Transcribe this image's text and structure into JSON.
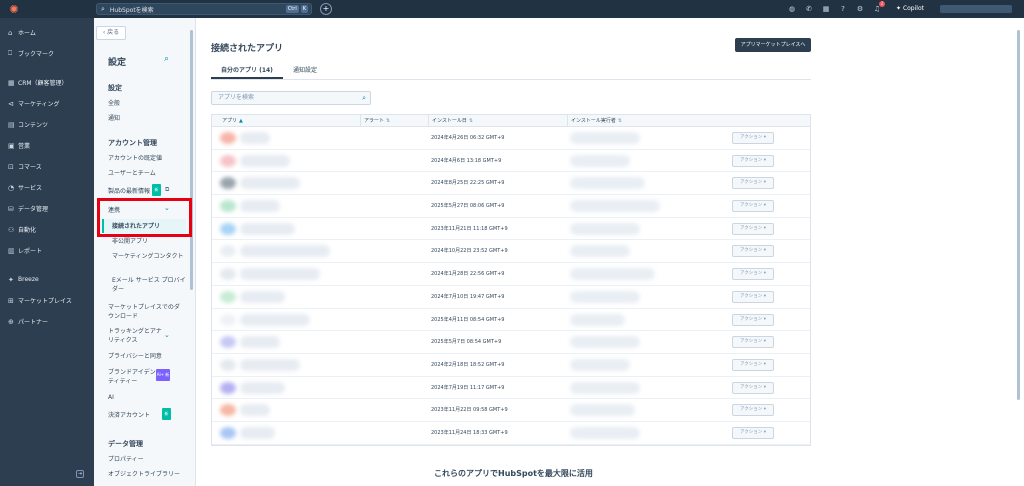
{
  "topbar": {
    "logo": "✺",
    "search_placeholder": "HubSpotを検索",
    "shortcut_keys": [
      "Ctrl",
      "K"
    ],
    "copilot_label": "Copilot",
    "notification_count": "1"
  },
  "nav": {
    "items": [
      {
        "icon": "⌂",
        "label": "ホーム"
      },
      {
        "icon": "⎕",
        "label": "ブックマーク"
      },
      {
        "icon": "▦",
        "label": "CRM（顧客管理）"
      },
      {
        "icon": "⊲",
        "label": "マーケティング"
      },
      {
        "icon": "▤",
        "label": "コンテンツ"
      },
      {
        "icon": "▣",
        "label": "営業"
      },
      {
        "icon": "⊡",
        "label": "コマース"
      },
      {
        "icon": "◔",
        "label": "サービス"
      },
      {
        "icon": "⛁",
        "label": "データ管理"
      },
      {
        "icon": "⚇",
        "label": "自動化"
      },
      {
        "icon": "▥",
        "label": "レポート"
      }
    ],
    "items2": [
      {
        "icon": "✦",
        "label": "Breeze"
      },
      {
        "icon": "⊞",
        "label": "マーケットプレイス"
      },
      {
        "icon": "⊕",
        "label": "パートナー"
      }
    ]
  },
  "settings": {
    "back_label": "‹ 戻る",
    "title": "設定",
    "sections": {
      "settings_head": "設定",
      "general": "全般",
      "notifications": "通知",
      "account_head": "アカウント管理",
      "account_defaults": "アカウントの既定値",
      "users_teams": "ユーザーとチーム",
      "product_updates": "製品の最新情報",
      "integrations": "連携",
      "connected_apps": "接続されたアプリ",
      "private_apps": "非公開アプリ",
      "marketing_contacts": "マーケティングコンタクト",
      "email_providers": "Eメール サービス プロバイダー",
      "marketplace_downloads": "マーケットプレイスでのダウンロード",
      "tracking_analytics": "トラッキングとアナリティクス",
      "privacy": "プライバシーと同意",
      "brand_identity": "ブランドアイデンティティー",
      "brand_badge": "AI+ 新",
      "ai": "AI",
      "payment_account": "決済アカウント",
      "new_badge": "新",
      "data_head": "データ管理",
      "properties": "プロパティー",
      "object_library": "オブジェクトライブラリー"
    }
  },
  "main": {
    "title": "接続されたアプリ",
    "marketplace_button": "アプリマーケットプレイスへ",
    "tabs": [
      "自分のアプリ (14)",
      "通知設定"
    ],
    "search_placeholder": "アプリを検索",
    "columns": [
      "アプリ",
      "アラート",
      "インストール日",
      "インストール実行者"
    ],
    "action_label": "アクション ▾",
    "rows": [
      {
        "date": "2024年4月26日 06:32 GMT+9",
        "color": "#f7b4a7"
      },
      {
        "date": "2024年4月6日 13:18 GMT+9",
        "color": "#f6c3c8"
      },
      {
        "date": "2024年8月25日 22:25 GMT+9",
        "color": "#9aa4ad"
      },
      {
        "date": "2025年5月27日 08:06 GMT+9",
        "color": "#b9e6cf"
      },
      {
        "date": "2023年11月21日 11:18 GMT+9",
        "color": "#a9d3f5"
      },
      {
        "date": "2024年10月22日 23:52 GMT+9",
        "color": "#e9eef4"
      },
      {
        "date": "2024年1月28日 22:56 GMT+9",
        "color": "#e4e9ef"
      },
      {
        "date": "2024年7月10日 19:47 GMT+9",
        "color": "#c6ecd4"
      },
      {
        "date": "2025年4月11日 08:54 GMT+9",
        "color": "#eef1f5"
      },
      {
        "date": "2025年5月7日 08:54 GMT+9",
        "color": "#c7c9f5"
      },
      {
        "date": "2024年2月18日 18:52 GMT+9",
        "color": "#e4e9ef"
      },
      {
        "date": "2024年7月19日 11:17 GMT+9",
        "color": "#b5b0f2"
      },
      {
        "date": "2023年11月22日 09:58 GMT+9",
        "color": "#f6b7a3"
      },
      {
        "date": "2023年11月24日 18:33 GMT+9",
        "color": "#a9c6f5"
      }
    ],
    "bottom_title": "これらのアプリでHubSpotを最大限に活用"
  }
}
